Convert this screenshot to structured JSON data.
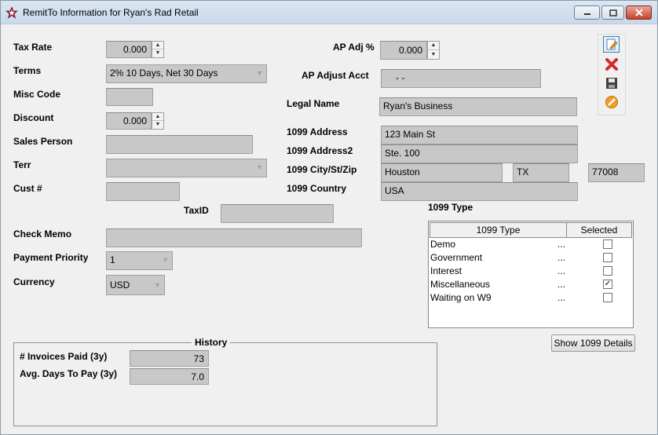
{
  "window": {
    "title": "RemitTo Information for Ryan's Rad Retail",
    "controls": [
      "minimize",
      "maximize",
      "close"
    ]
  },
  "left": {
    "tax_rate": {
      "label": "Tax Rate",
      "value": "0.000"
    },
    "terms": {
      "label": "Terms",
      "value": "2% 10 Days, Net 30 Days"
    },
    "misc_code": {
      "label": "Misc Code",
      "value": ""
    },
    "discount": {
      "label": "Discount",
      "value": "0.000"
    },
    "sales_person": {
      "label": "Sales Person",
      "value": ""
    },
    "terr": {
      "label": "Terr",
      "value": ""
    },
    "cust_num": {
      "label": "Cust #",
      "value": ""
    },
    "tax_id": {
      "label": "TaxID",
      "value": ""
    },
    "check_memo": {
      "label": "Check Memo",
      "value": ""
    },
    "payment_priority": {
      "label": "Payment Priority",
      "value": "1"
    },
    "currency": {
      "label": "Currency",
      "value": "USD"
    }
  },
  "right": {
    "ap_adj_pct": {
      "label": "AP Adj %",
      "value": "0.000"
    },
    "ap_adjust_acct": {
      "label": "AP Adjust Acct",
      "value": "-  -"
    },
    "legal_name": {
      "label": "Legal Name",
      "value": "Ryan's Business"
    },
    "address1": {
      "label": "1099 Address",
      "value": "123 Main St"
    },
    "address2": {
      "label": "1099 Address2",
      "value": "Ste. 100"
    },
    "city_st_zip": {
      "label": "1099 City/St/Zip",
      "city": "Houston",
      "state": "TX",
      "zip": "77008"
    },
    "country": {
      "label": "1099 Country",
      "value": "USA"
    }
  },
  "toolbar": {
    "icons": [
      "edit-icon",
      "delete-icon",
      "save-icon",
      "cancel-icon"
    ]
  },
  "type_1099": {
    "section_label": "1099 Type",
    "columns": [
      "1099 Type",
      "Selected"
    ],
    "rows": [
      {
        "name": "Demo",
        "dots": "...",
        "selected": false,
        "mark": ""
      },
      {
        "name": "Government",
        "dots": "...",
        "selected": false,
        "mark": ""
      },
      {
        "name": "Interest",
        "dots": "...",
        "selected": false,
        "mark": ""
      },
      {
        "name": "Miscellaneous",
        "dots": "...",
        "selected": true,
        "mark": "✓"
      },
      {
        "name": "Waiting on W9",
        "dots": "...",
        "selected": false,
        "mark": ""
      }
    ],
    "details_button": "Show 1099 Details"
  },
  "history": {
    "title": "History",
    "invoices_paid": {
      "label": "# Invoices Paid (3y)",
      "value": "73"
    },
    "avg_days": {
      "label": "Avg. Days To Pay (3y)",
      "value": "7.0"
    }
  }
}
